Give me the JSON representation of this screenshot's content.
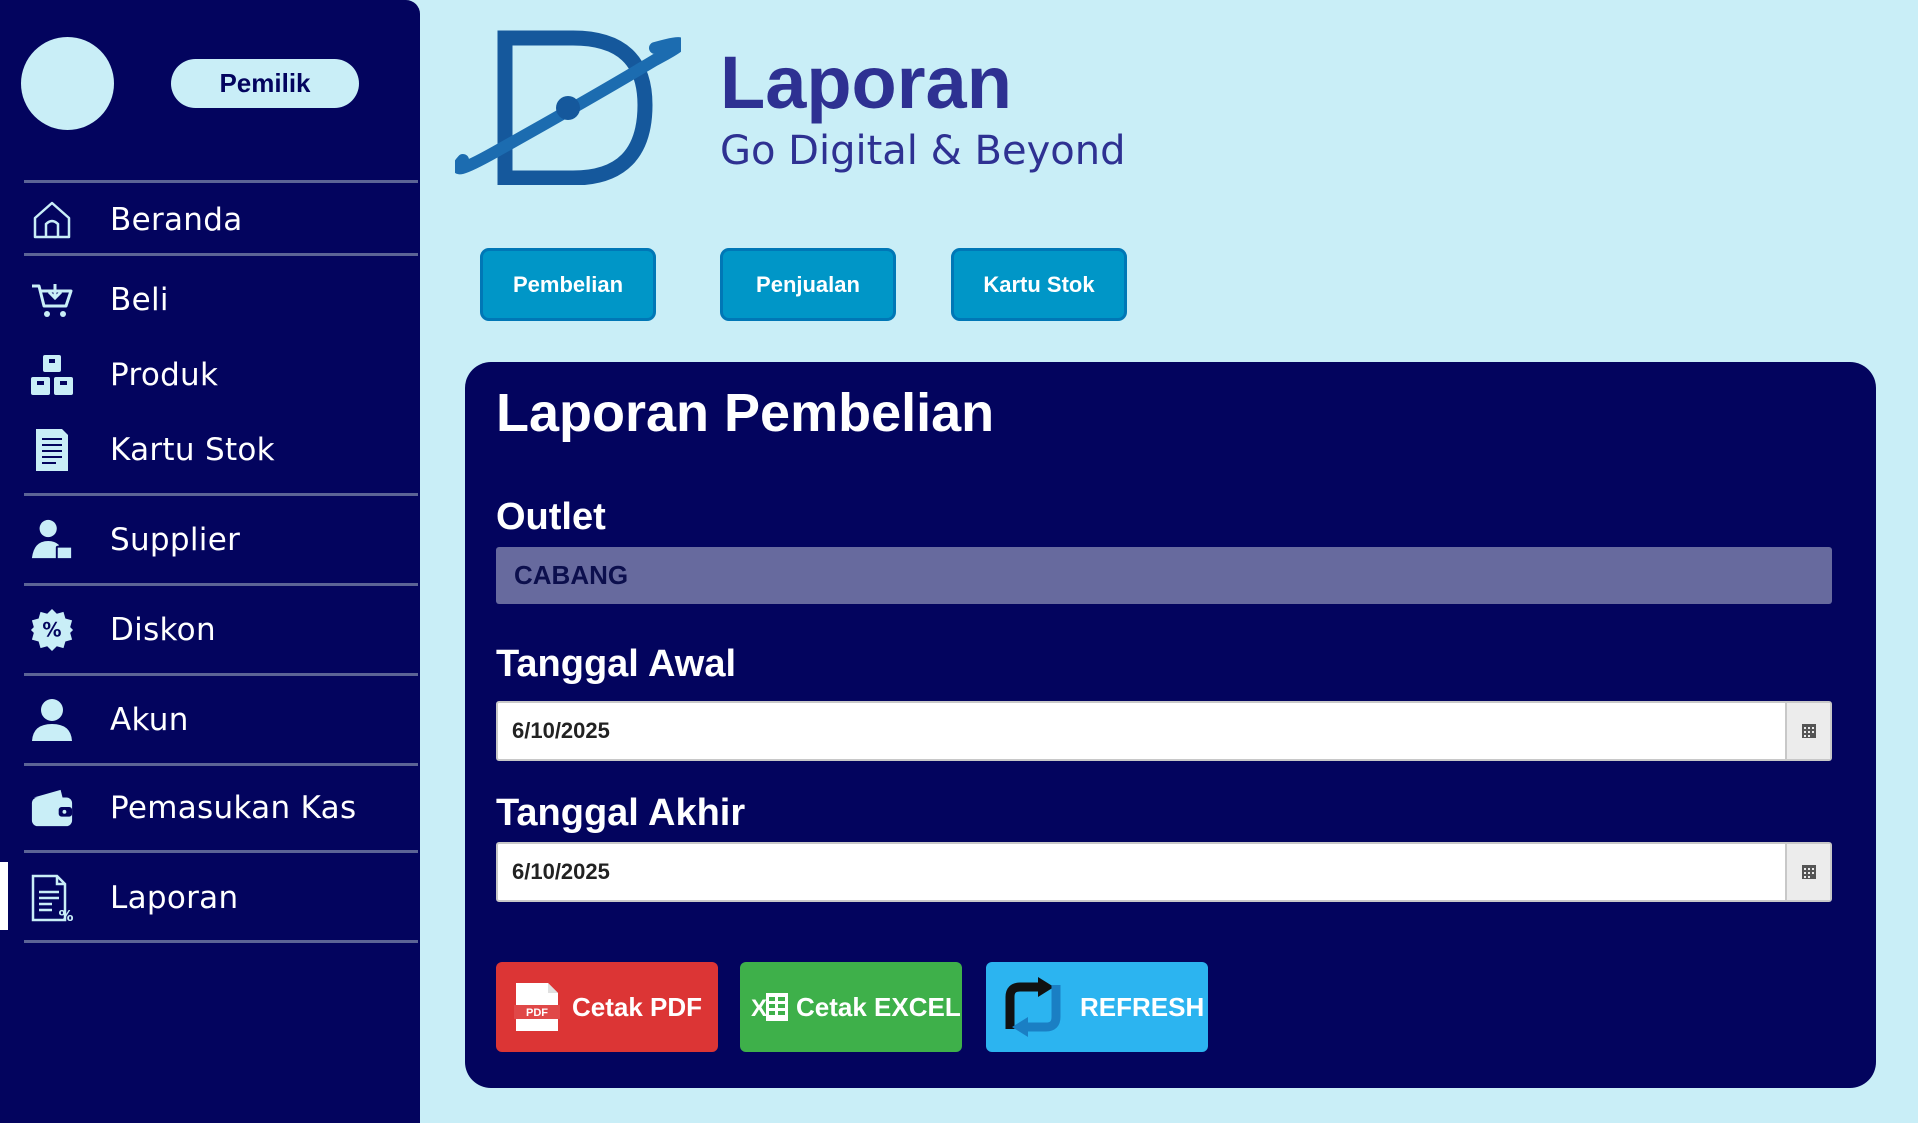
{
  "sidebar": {
    "role": "Pemilik",
    "items": [
      {
        "label": "Beranda",
        "icon": "home-icon"
      },
      {
        "label": "Beli",
        "icon": "cart-icon"
      },
      {
        "label": "Produk",
        "icon": "boxes-icon"
      },
      {
        "label": "Kartu Stok",
        "icon": "list-document-icon"
      },
      {
        "label": "Supplier",
        "icon": "supplier-icon"
      },
      {
        "label": "Diskon",
        "icon": "discount-icon"
      },
      {
        "label": "Akun",
        "icon": "user-icon"
      },
      {
        "label": "Pemasukan Kas",
        "icon": "wallet-icon"
      },
      {
        "label": "Laporan",
        "icon": "report-icon"
      }
    ],
    "active": "Laporan"
  },
  "header": {
    "title": "Laporan",
    "subtitle": "Go Digital & Beyond"
  },
  "tabs": [
    {
      "label": "Pembelian"
    },
    {
      "label": "Penjualan"
    },
    {
      "label": "Kartu Stok"
    }
  ],
  "panel": {
    "title": "Laporan Pembelian",
    "outlet_label": "Outlet",
    "outlet_value": "CABANG",
    "start_label": "Tanggal Awal",
    "start_value": "6/10/2025",
    "end_label": "Tanggal Akhir",
    "end_value": "6/10/2025",
    "pdf_label": "Cetak PDF",
    "pdf_icon_text": "PDF",
    "excel_label": "Cetak EXCEL",
    "excel_icon_text": "X",
    "refresh_label": "REFRESH"
  },
  "colors": {
    "sidebar_bg": "#03045e",
    "page_bg": "#c9eef7",
    "tab_bg": "#0096c7",
    "pdf_bg": "#dc3535",
    "excel_bg": "#3eb04a",
    "refresh_bg": "#2cb4f0",
    "brand": "#2e3192"
  }
}
